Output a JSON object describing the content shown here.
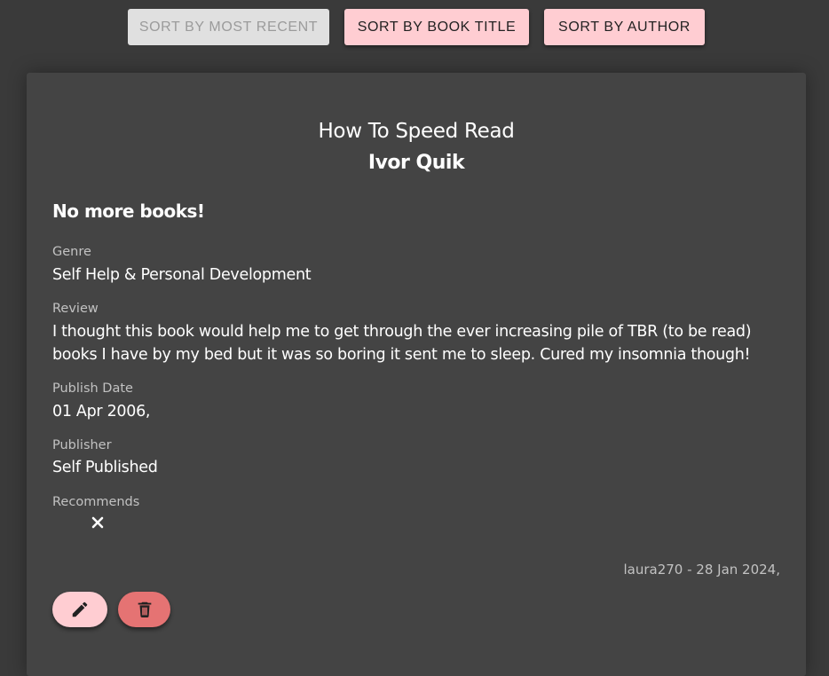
{
  "sort_bar": {
    "most_recent_label": "SORT BY MOST RECENT",
    "book_title_label": "SORT BY BOOK TITLE",
    "author_label": "SORT BY AUTHOR"
  },
  "book": {
    "title": "How To Speed Read",
    "author": "Ivor Quik",
    "headline": "No more books!",
    "genre_label": "Genre",
    "genre": "Self Help & Personal Development",
    "review_label": "Review",
    "review": "I thought this book would help me to get through the ever increasing pile of TBR (to be read) books I have by my bed but it was so boring it sent me to sleep. Cured my insomnia though!",
    "publish_date_label": "Publish Date",
    "publish_date": "01 Apr 2006,",
    "publisher_label": "Publisher",
    "publisher": "Self Published",
    "recommends_label": "Recommends",
    "recommends_icon": "close-icon",
    "posted_by": "laura270 - 28 Jan 2024,"
  },
  "actions": {
    "edit_icon": "pencil-icon",
    "delete_icon": "trash-icon"
  },
  "colors": {
    "page_background": "#3a3a3a",
    "card_background": "#444444",
    "accent_pink": "#ffcdd2",
    "delete_red": "#e57373",
    "disabled_button": "#e0e0e0"
  }
}
